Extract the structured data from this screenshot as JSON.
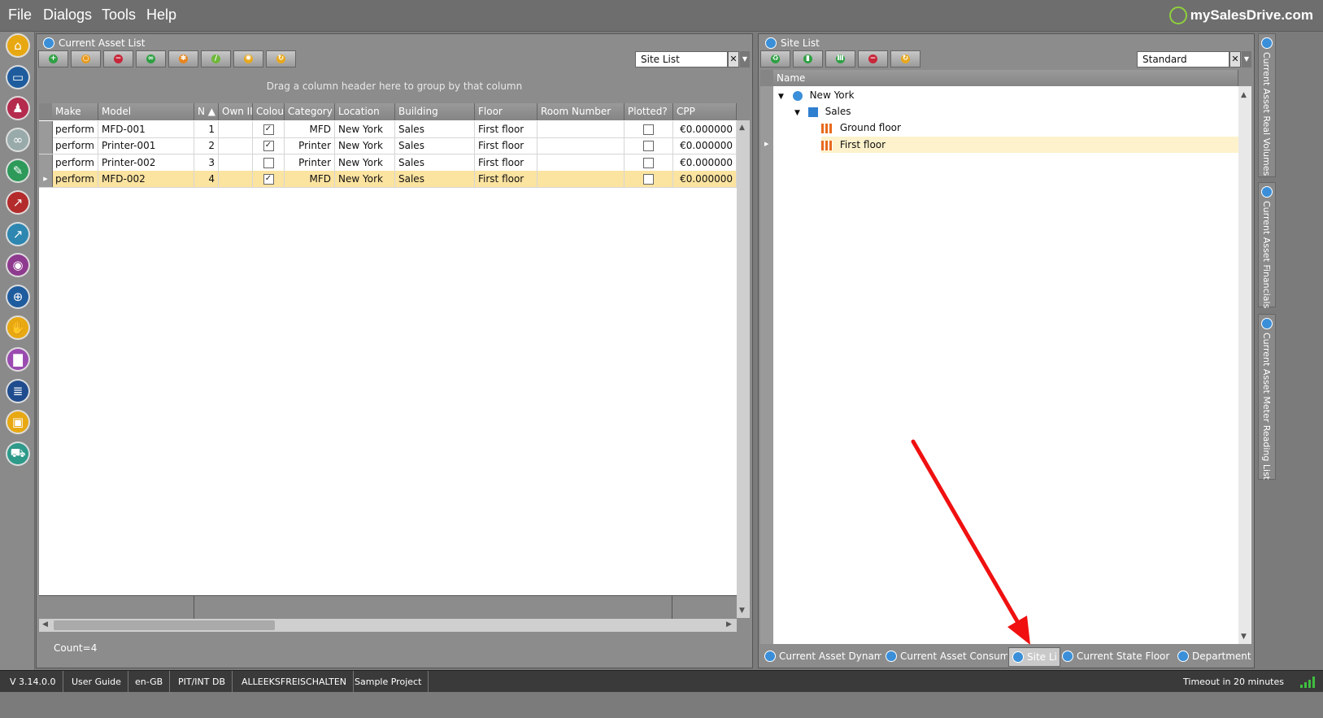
{
  "menu": [
    "File",
    "Dialogs",
    "Tools",
    "Help"
  ],
  "logo": "mySalesDrive.com",
  "sidebar_icons": [
    {
      "name": "home-icon",
      "glyph": "⌂",
      "color": "#e8a812"
    },
    {
      "name": "folder-icon",
      "glyph": "▭",
      "color": "#1f5c9e"
    },
    {
      "name": "hierarchy-icon",
      "glyph": "♟",
      "color": "#b42b4d"
    },
    {
      "name": "binoculars-icon",
      "glyph": "∞",
      "color": "#9aa"
    },
    {
      "name": "scroll-icon",
      "glyph": "✎",
      "color": "#2d9a5a"
    },
    {
      "name": "chart-icon",
      "glyph": "↗",
      "color": "#b42b2b"
    },
    {
      "name": "trend-icon",
      "glyph": "↗",
      "color": "#2d87b0"
    },
    {
      "name": "eye-icon",
      "glyph": "◉",
      "color": "#8e3a8e"
    },
    {
      "name": "target-icon",
      "glyph": "⊕",
      "color": "#1f5c9e"
    },
    {
      "name": "handshake-icon",
      "glyph": "✋",
      "color": "#e8a812"
    },
    {
      "name": "bar-icon",
      "glyph": "▇",
      "color": "#9a4ab0"
    },
    {
      "name": "document-icon",
      "glyph": "≣",
      "color": "#1f4c8e"
    },
    {
      "name": "briefcase-icon",
      "glyph": "▣",
      "color": "#e8a812"
    },
    {
      "name": "truck-icon",
      "glyph": "⛟",
      "color": "#2d9a8a"
    }
  ],
  "asset_panel": {
    "title": "Current Asset List",
    "combo_value": "Site List",
    "group_hint": "Drag a column header here to group by that column",
    "toolbar": [
      {
        "name": "add-icon",
        "glyph": "+",
        "color": "#2ea043"
      },
      {
        "name": "refresh-cycle-icon",
        "glyph": "○",
        "color": "#e89a1e"
      },
      {
        "name": "remove-icon",
        "glyph": "−",
        "color": "#c8263a"
      },
      {
        "name": "link-icon",
        "glyph": "∞",
        "color": "#2ea043"
      },
      {
        "name": "star-icon",
        "glyph": "✱",
        "color": "#e8851e"
      },
      {
        "name": "attach-icon",
        "glyph": "/",
        "color": "#6fb83a"
      },
      {
        "name": "settings-icon",
        "glyph": "✺",
        "color": "#e8a81e"
      },
      {
        "name": "sync-icon",
        "glyph": "↻",
        "color": "#e8a81e"
      }
    ],
    "columns": [
      "Make",
      "Model",
      "N ▲",
      "Own II",
      "Colou",
      "Category",
      "Location",
      "Building",
      "Floor",
      "Room Number",
      "Plotted?",
      "CPP"
    ],
    "rows": [
      {
        "make": "perform I",
        "model": "MFD-001",
        "n": "1",
        "own": "",
        "colour": true,
        "category": "MFD",
        "location": "New York",
        "building": "Sales",
        "floor": "First floor",
        "room": "",
        "plotted": false,
        "cpp": "€0.000000"
      },
      {
        "make": "perform I",
        "model": "Printer-001",
        "n": "2",
        "own": "",
        "colour": true,
        "category": "Printer",
        "location": "New York",
        "building": "Sales",
        "floor": "First floor",
        "room": "",
        "plotted": false,
        "cpp": "€0.000000"
      },
      {
        "make": "perform I",
        "model": "Printer-002",
        "n": "3",
        "own": "",
        "colour": false,
        "category": "Printer",
        "location": "New York",
        "building": "Sales",
        "floor": "First floor",
        "room": "",
        "plotted": false,
        "cpp": "€0.000000"
      },
      {
        "make": "perform I",
        "model": "MFD-002",
        "n": "4",
        "own": "",
        "colour": true,
        "category": "MFD",
        "location": "New York",
        "building": "Sales",
        "floor": "First floor",
        "room": "",
        "plotted": false,
        "cpp": "€0.000000"
      }
    ],
    "selected_row": 3,
    "count": "Count=4"
  },
  "site_panel": {
    "title": "Site List",
    "combo_value": "Standard",
    "column": "Name",
    "toolbar": [
      {
        "name": "recycle-icon",
        "glyph": "♻",
        "color": "#2ea043"
      },
      {
        "name": "building-add-icon",
        "glyph": "▮",
        "color": "#2ea043"
      },
      {
        "name": "floor-add-icon",
        "glyph": "Ⅲ",
        "color": "#2ea043"
      },
      {
        "name": "remove-icon",
        "glyph": "−",
        "color": "#c8263a"
      },
      {
        "name": "sync-icon",
        "glyph": "↻",
        "color": "#e8a81e"
      }
    ],
    "tree": {
      "location": "New York",
      "building": "Sales",
      "floors": [
        "Ground floor",
        "First floor"
      ]
    }
  },
  "bottom_tabs": [
    {
      "label": "Current Asset Dynami",
      "active": false
    },
    {
      "label": "Current Asset Consuma",
      "active": false
    },
    {
      "label": "Site Li",
      "active": true
    },
    {
      "label": "Current State Floor P",
      "active": false
    },
    {
      "label": "Department",
      "active": false
    }
  ],
  "right_tabs": [
    "Current Asset Real Volumes",
    "Current Asset Financials",
    "Current Asset Meter Reading List"
  ],
  "status": [
    "V 3.14.0.0",
    "User Guide",
    "en-GB",
    "PIT/INT DB",
    "ALLEEKSFREISCHALTEN",
    "Sample Project"
  ],
  "timeout": "Timeout in 20 minutes"
}
